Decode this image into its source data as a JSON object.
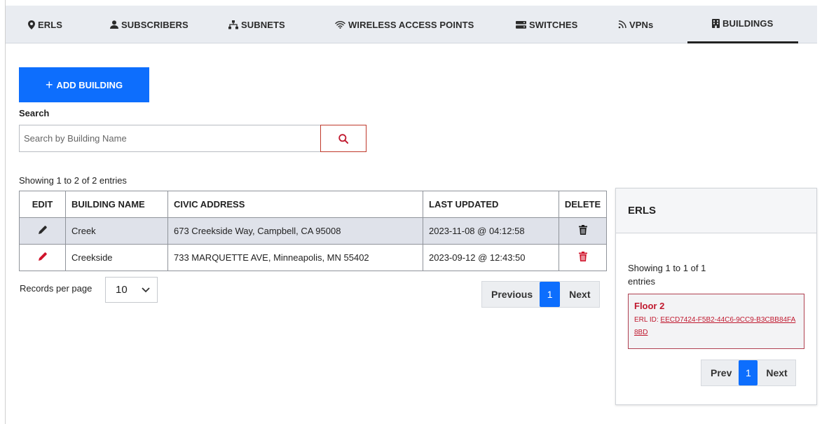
{
  "tabs": [
    {
      "label": "ERLS",
      "icon": "map-pin-icon"
    },
    {
      "label": "SUBSCRIBERS",
      "icon": "user-icon"
    },
    {
      "label": "SUBNETS",
      "icon": "network-icon"
    },
    {
      "label": "WIRELESS ACCESS POINTS",
      "icon": "wifi-icon"
    },
    {
      "label": "SWITCHES",
      "icon": "switch-icon"
    },
    {
      "label": "VPNs",
      "icon": "rss-icon"
    },
    {
      "label": "BUILDINGS",
      "icon": "building-icon",
      "active": true
    }
  ],
  "toolbar": {
    "add_label": "ADD BUILDING",
    "add_icon": "+"
  },
  "search": {
    "label": "Search",
    "placeholder": "Search by Building Name",
    "value": ""
  },
  "table": {
    "showing": "Showing 1 to 2 of 2 entries",
    "headers": [
      "EDIT",
      "BUILDING NAME",
      "CIVIC ADDRESS",
      "LAST UPDATED",
      "DELETE"
    ],
    "rows": [
      {
        "name": "Creek",
        "address": "673 Creekside Way, Campbell, CA 95008",
        "updated": "2023-11-08 @ 04:12:58"
      },
      {
        "name": "Creekside",
        "address": "733 MARQUETTE AVE, Minneapolis, MN 55402",
        "updated": "2023-09-12 @ 12:43:50"
      }
    ]
  },
  "records": {
    "label": "Records per page",
    "value": "10"
  },
  "pager": {
    "prev": "Previous",
    "page": "1",
    "next": "Next"
  },
  "erls_panel": {
    "title": "ERLS",
    "showing": "Showing 1 to 1 of 1 entries",
    "items": [
      {
        "name": "Floor 2",
        "id_label": "ERL ID:",
        "id_value": "EECD7424-F5B2-44C6-9CC9-B3CBB84FA8BD"
      }
    ],
    "pager": {
      "prev": "Prev",
      "page": "1",
      "next": "Next"
    }
  },
  "colors": {
    "primary": "#0d6efd",
    "danger": "#c0182e",
    "row_highlight": "#dfe2ea"
  }
}
